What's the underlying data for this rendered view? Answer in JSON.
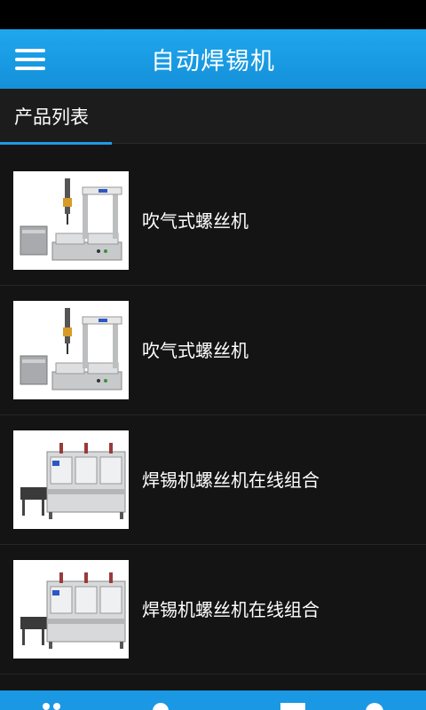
{
  "app": {
    "title": "自动焊锡机"
  },
  "section": {
    "tab_label": "产品列表"
  },
  "products": [
    {
      "name": "吹气式螺丝机",
      "image": "desktop-screw-machine"
    },
    {
      "name": "吹气式螺丝机",
      "image": "desktop-screw-machine"
    },
    {
      "name": "焊锡机螺丝机在线组合",
      "image": "inline-production-line"
    },
    {
      "name": "焊锡机螺丝机在线组合",
      "image": "inline-production-line"
    }
  ],
  "bottom_nav": [
    "home-icon",
    "location-icon",
    "message-icon",
    "phone-icon"
  ]
}
